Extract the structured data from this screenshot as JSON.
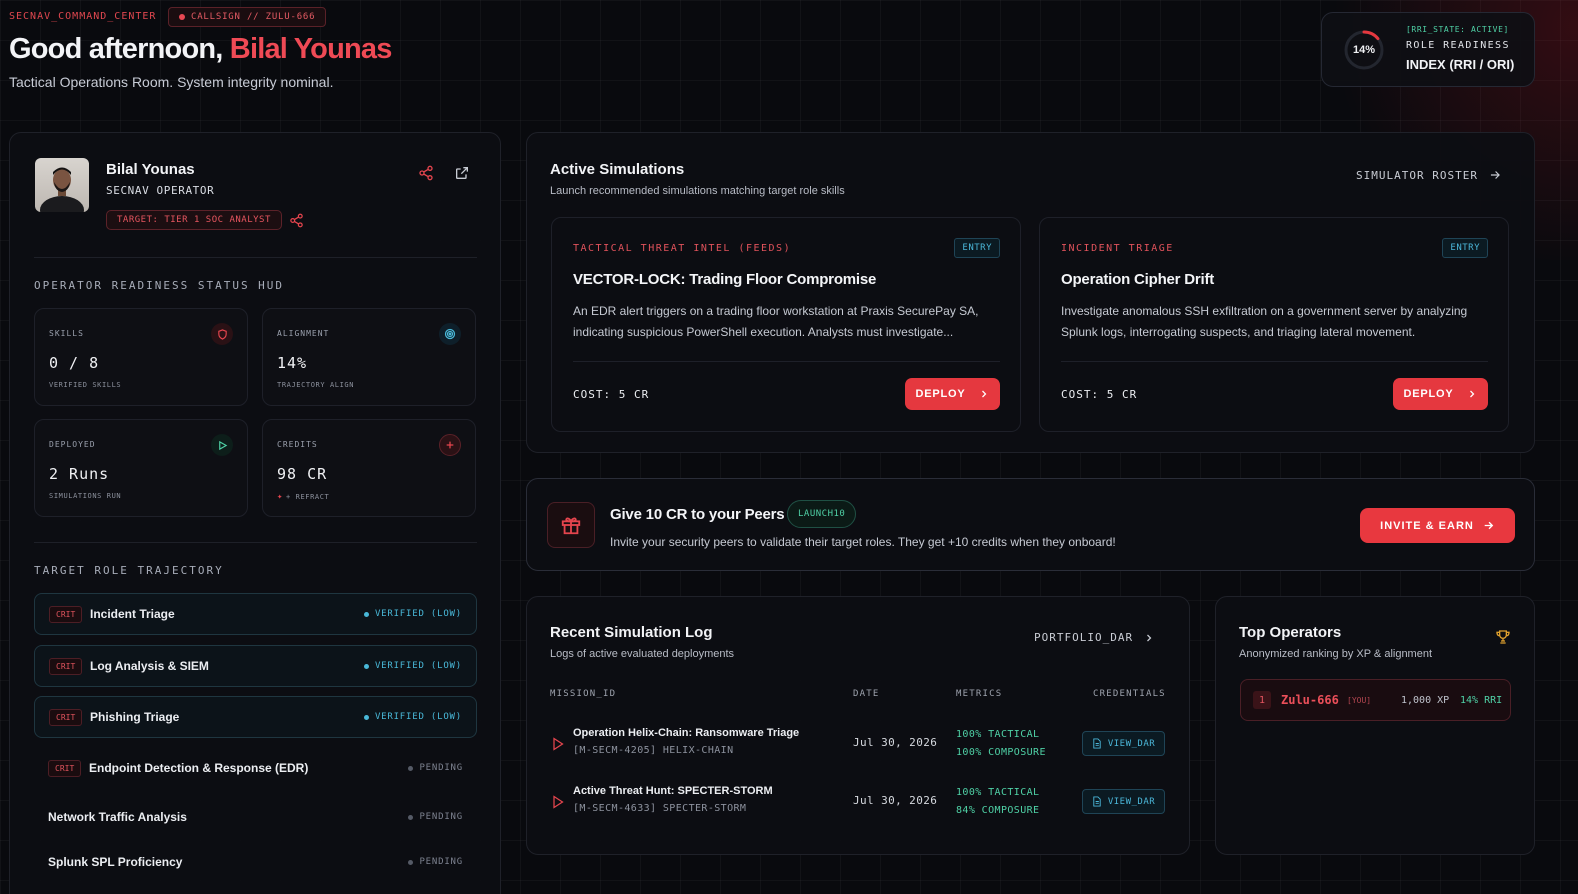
{
  "header": {
    "system_label": "SECNAV_COMMAND_CENTER",
    "callsign": "CALLSIGN // ZULU-666",
    "greeting_prefix": "Good afternoon, ",
    "user_name": "Bilal Younas",
    "subtitle": "Tactical Operations Room. System integrity nominal."
  },
  "rri": {
    "percent": "14%",
    "fraction": 0.14,
    "state": "[RRI_STATE: ACTIVE]",
    "line1": "ROLE READINESS",
    "line2": "INDEX (RRI / ORI)"
  },
  "profile": {
    "name": "Bilal Younas",
    "role": "SECNAV OPERATOR",
    "target": "TARGET: TIER 1 SOC ANALYST"
  },
  "hud": {
    "title": "OPERATOR READINESS STATUS HUD",
    "stats": [
      {
        "label": "SKILLS",
        "value": "0 / 8",
        "sub": "VERIFIED SKILLS",
        "icon": "shield-icon"
      },
      {
        "label": "ALIGNMENT",
        "value": "14%",
        "sub": "TRAJECTORY ALIGN",
        "icon": "target-icon"
      },
      {
        "label": "DEPLOYED",
        "value": "2 Runs",
        "sub": "SIMULATIONS RUN",
        "icon": "play-icon"
      },
      {
        "label": "CREDITS",
        "value": "98 CR",
        "sub": "+ REFRACT",
        "icon": "plus-icon"
      }
    ]
  },
  "trajectory": {
    "title": "TARGET ROLE TRAJECTORY",
    "crit_label": "CRIT",
    "items": [
      {
        "name": "Incident Triage",
        "status": "VERIFIED (LOW)"
      },
      {
        "name": "Log Analysis & SIEM",
        "status": "VERIFIED (LOW)"
      },
      {
        "name": "Phishing Triage",
        "status": "VERIFIED (LOW)"
      },
      {
        "name": "Endpoint Detection & Response (EDR)",
        "status": "PENDING"
      },
      {
        "name": "Network Traffic Analysis",
        "status": "PENDING"
      },
      {
        "name": "Splunk SPL Proficiency",
        "status": "PENDING"
      }
    ]
  },
  "simulations": {
    "title": "Active Simulations",
    "subtitle": "Launch recommended simulations matching target role skills",
    "roster_link": "SIMULATOR ROSTER",
    "cards": [
      {
        "category": "TACTICAL THREAT INTEL (FEEDS)",
        "level": "ENTRY",
        "title": "VECTOR-LOCK: Trading Floor Compromise",
        "description": "An EDR alert triggers on a trading floor workstation at Praxis SecurePay SA, indicating suspicious PowerShell execution. Analysts must investigate...",
        "cost": "COST: 5 CR",
        "button": "DEPLOY"
      },
      {
        "category": "INCIDENT TRIAGE",
        "level": "ENTRY",
        "title": "Operation Cipher Drift",
        "description": "Investigate anomalous SSH exfiltration on a government server by analyzing Splunk logs, interrogating suspects, and triaging lateral movement.",
        "cost": "COST: 5 CR",
        "button": "DEPLOY"
      }
    ]
  },
  "referral": {
    "title": "Give 10 CR to your Peers",
    "code": "LAUNCH10",
    "subtitle": "Invite your security peers to validate their target roles. They get +10 credits when they onboard!",
    "button": "INVITE & EARN"
  },
  "log": {
    "title": "Recent Simulation Log",
    "subtitle": "Logs of active evaluated deployments",
    "portfolio_link": "PORTFOLIO_DAR",
    "columns": [
      "MISSION_ID",
      "DATE",
      "METRICS",
      "CREDENTIALS"
    ],
    "rows": [
      {
        "name": "Operation Helix-Chain: Ransomware Triage",
        "id": "[M-SECM-4205] HELIX-CHAIN",
        "date": "Jul 30, 2026",
        "metric1": "100% TACTICAL",
        "metric2": "100% COMPOSURE",
        "action": "VIEW_DAR"
      },
      {
        "name": "Active Threat Hunt: SPECTER-STORM",
        "id": "[M-SECM-4633] SPECTER-STORM",
        "date": "Jul 30, 2026",
        "metric1": "100% TACTICAL",
        "metric2": "84% COMPOSURE",
        "action": "VIEW_DAR"
      }
    ]
  },
  "top_operators": {
    "title": "Top Operators",
    "subtitle": "Anonymized ranking by XP & alignment",
    "entries": [
      {
        "rank": "1",
        "callsign": "Zulu-666",
        "tag": "[YOU]",
        "xp": "1,000 XP",
        "rri": "14% RRI"
      }
    ]
  },
  "colors": {
    "accent_red": "#e5383f",
    "accent_teal": "#4fd1a6",
    "accent_cyan": "#49b8d8",
    "background": "#090a0e"
  }
}
